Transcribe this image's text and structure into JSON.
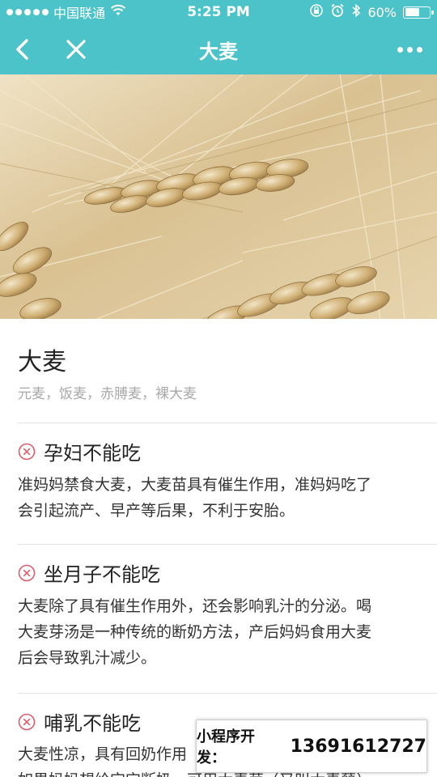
{
  "status_bar": {
    "carrier": "中国联通",
    "time": "5:25 PM",
    "battery_percent": "60%",
    "battery_level": 0.6,
    "icons": [
      "signal-dots-icon",
      "wifi-icon",
      "orientation-lock-icon",
      "alarm-icon",
      "bluetooth-icon",
      "battery-icon"
    ]
  },
  "nav": {
    "title": "大麦",
    "back_icon": "chevron-left-icon",
    "close_icon": "close-icon",
    "more_icon": "more-dots-icon"
  },
  "colors": {
    "header_bg": "#4cc3c9",
    "x_icon": "#e05a6a"
  },
  "food": {
    "name": "大麦",
    "aliases": "元麦，饭麦，赤膊麦，裸大麦"
  },
  "sections": [
    {
      "title": "孕妇不能吃",
      "icon": "x-circle-icon",
      "lines": [
        "准妈妈禁食大麦，大麦苗具有催生作用，准妈妈吃了",
        "会引起流产、早产等后果，不利于安胎。"
      ]
    },
    {
      "title": "坐月子不能吃",
      "icon": "x-circle-icon",
      "lines": [
        "大麦除了具有催生作用外，还会影响乳汁的分泌。喝",
        "大麦芽汤是一种传统的断奶方法，产后妈妈食用大麦",
        "后会导致乳汁减少。"
      ]
    },
    {
      "title": "哺乳不能吃",
      "icon": "x-circle-icon",
      "lines": [
        "大麦性凉，具有回奶作用",
        "如果妈妈想给宝宝断奶，可用大麦芽（又叫大麦蘖）"
      ]
    }
  ],
  "ad": {
    "label": "小程序开发：",
    "phone": "13691612727"
  }
}
